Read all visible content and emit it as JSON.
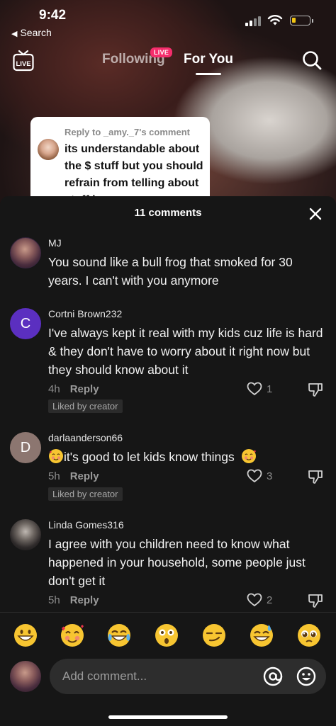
{
  "status_bar": {
    "time": "9:42",
    "back_label": "Search",
    "battery_level": 0.2
  },
  "nav": {
    "live_label": "LIVE",
    "tabs": [
      {
        "label": "Following",
        "badge": "LIVE",
        "active": false
      },
      {
        "label": "For You",
        "active": true
      }
    ]
  },
  "reply_card": {
    "reply_to": "Reply to _amy._7's comment",
    "text": "its understandable about the $ stuff but you should refrain from telling about stuff i"
  },
  "sheet": {
    "title": "11 comments",
    "comments": [
      {
        "user": "MJ",
        "text": "You sound like a bull frog that smoked for 30 years.  I can't with you anymore"
      },
      {
        "user": "Cortni Brown232",
        "avatar_letter": "C",
        "text": "I've always kept it real with my kids cuz life is hard & they don't have to worry about it right now but they should know about it",
        "age": "4h",
        "reply_label": "Reply",
        "likes": "1",
        "tag": "Liked by creator"
      },
      {
        "user": "darlaanderson66",
        "avatar_letter": "D",
        "text_prefix_emoji": "smiling-face-with-hearts",
        "text": "it's good to let kids know things",
        "text_suffix_emoji": "smiling-face-with-hearts",
        "age": "5h",
        "reply_label": "Reply",
        "likes": "3",
        "tag": "Liked by creator"
      },
      {
        "user": "Linda Gomes316",
        "text": "I agree with you children need to know what happened in your household, some people just don't get it",
        "age": "5h",
        "reply_label": "Reply",
        "likes": "2"
      }
    ]
  },
  "emoji_bar": [
    "grinning-face",
    "smiling-face-with-hearts",
    "face-with-tears-of-joy",
    "astonished-face",
    "smirking-face",
    "grinning-face-with-sweat",
    "pleading-face"
  ],
  "input": {
    "placeholder": "Add comment..."
  },
  "colors": {
    "live_badge": "#f52d6c",
    "sheet_bg": "#161616",
    "input_bg": "#2d2d2d",
    "c_avatar": "#5b2fc0",
    "d_avatar": "#8c7670"
  }
}
